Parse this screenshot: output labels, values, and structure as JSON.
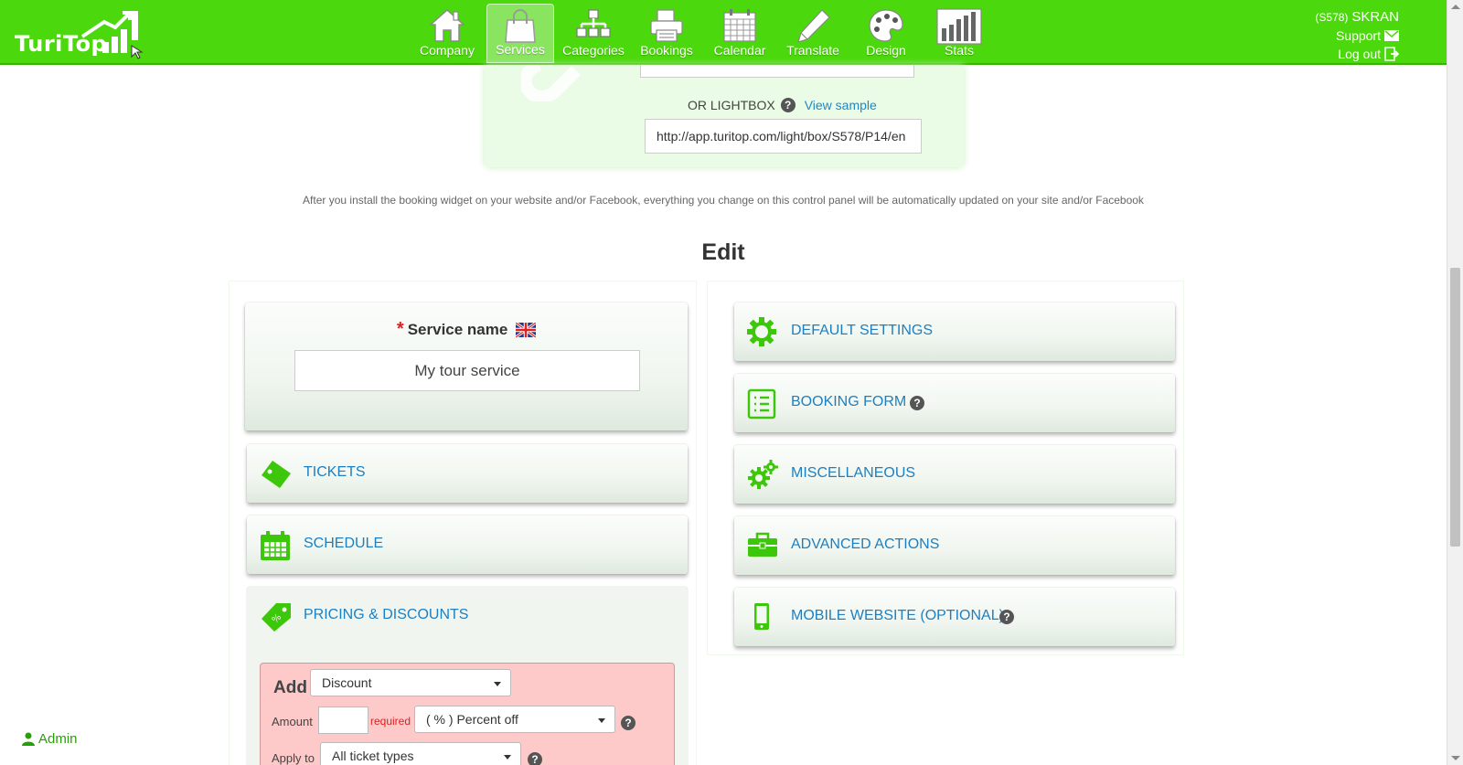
{
  "brand": {
    "logo_text": "TuriTop",
    "accent": "#4bd80c",
    "link_color": "#1e7fc0",
    "icon_green": "#3cc70a"
  },
  "nav": {
    "items": [
      {
        "label": "Company",
        "icon": "house-icon"
      },
      {
        "label": "Services",
        "icon": "shopping-bag-icon",
        "active": true
      },
      {
        "label": "Categories",
        "icon": "sitemap-icon"
      },
      {
        "label": "Bookings",
        "icon": "printer-icon"
      },
      {
        "label": "Calendar",
        "icon": "calendar-icon"
      },
      {
        "label": "Translate",
        "icon": "pen-icon"
      },
      {
        "label": "Design",
        "icon": "palette-icon"
      },
      {
        "label": "Stats",
        "icon": "bar-chart-icon"
      }
    ]
  },
  "account": {
    "code": "(S578)",
    "name": "SKRAN",
    "support_label": "Support",
    "logout_label": "Log out"
  },
  "widget": {
    "lightbox_label": "OR LIGHTBOX",
    "view_sample_label": "View sample",
    "lightbox_url": "http://app.turitop.com/light/box/S578/P14/en"
  },
  "info_text": "After you install the booking widget on your website and/or Facebook, everything you change on this control panel will be automatically updated on your site and/or Facebook",
  "edit_title": "Edit",
  "service_name": {
    "label": "Service name",
    "required_mark": "*",
    "value": "My tour service",
    "flag": "uk-flag-icon"
  },
  "left_sections": [
    {
      "label": "TICKETS",
      "icon": "ticket-icon"
    },
    {
      "label": "SCHEDULE",
      "icon": "calendar-icon"
    },
    {
      "label": "PRICING & DISCOUNTS",
      "icon": "price-tag-icon"
    }
  ],
  "right_sections": [
    {
      "label": "DEFAULT SETTINGS",
      "icon": "gear-icon"
    },
    {
      "label": "BOOKING FORM",
      "icon": "list-icon",
      "help": true
    },
    {
      "label": "MISCELLANEOUS",
      "icon": "gears-icon"
    },
    {
      "label": "ADVANCED ACTIONS",
      "icon": "toolbox-icon"
    },
    {
      "label": "MOBILE WEBSITE (OPTIONAL)",
      "icon": "mobile-icon",
      "help": true
    }
  ],
  "discount": {
    "add_label": "Add",
    "type_selected": "Discount",
    "amount_label": "Amount",
    "amount_value": "",
    "required_text": "required",
    "unit_selected": "( % ) Percent off",
    "apply_label": "Apply to",
    "apply_selected": "All ticket types"
  },
  "help_glyph": "?",
  "admin_label": "Admin"
}
